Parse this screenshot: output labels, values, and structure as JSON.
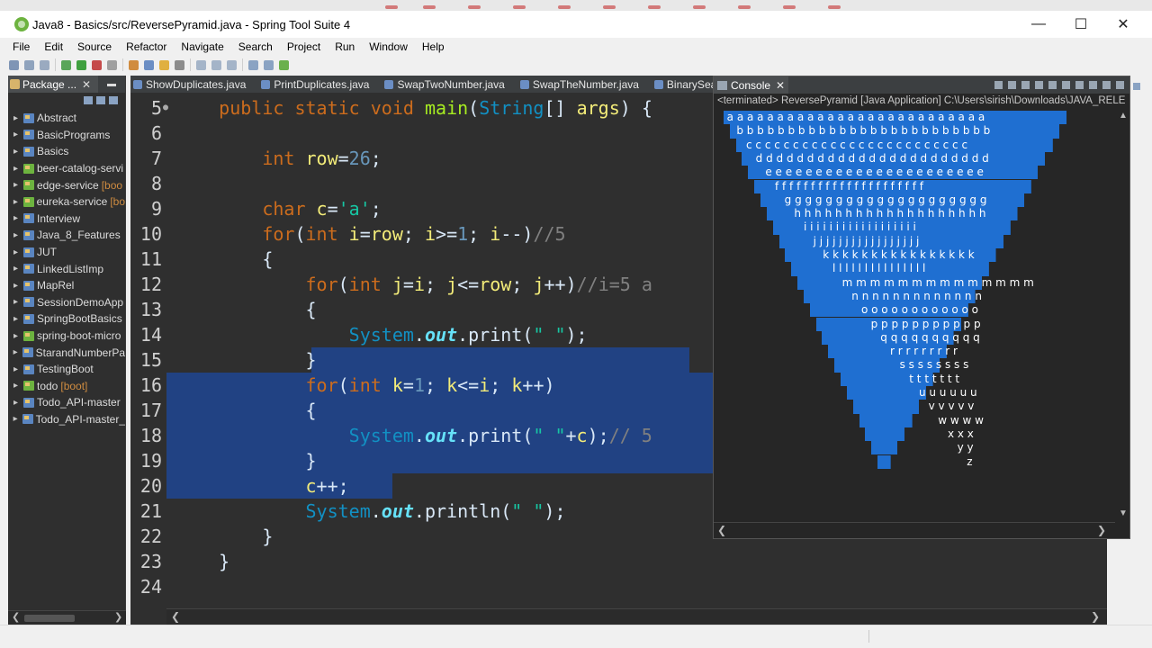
{
  "window": {
    "title": "Java8 - Basics/src/ReversePyramid.java - Spring Tool Suite 4",
    "minimize_icon": "minimize-icon",
    "maximize_icon": "maximize-icon",
    "close_icon": "close-icon",
    "minimize_glyph": "—",
    "maximize_glyph": "☐",
    "close_glyph": "✕"
  },
  "menu": [
    "File",
    "Edit",
    "Source",
    "Refactor",
    "Navigate",
    "Search",
    "Project",
    "Run",
    "Window",
    "Help"
  ],
  "package_explorer": {
    "tab_label": "Package ...",
    "projects": [
      {
        "name": "Abstract",
        "tag": "",
        "icon": "java-project-icon"
      },
      {
        "name": "BasicPrograms",
        "tag": "",
        "icon": "java-project-icon"
      },
      {
        "name": "Basics",
        "tag": "",
        "icon": "java-project-icon"
      },
      {
        "name": "beer-catalog-servi",
        "tag": "",
        "icon": "spring-project-icon"
      },
      {
        "name": "edge-service",
        "tag": "[boo",
        "icon": "spring-project-icon"
      },
      {
        "name": "eureka-service",
        "tag": "[bo",
        "icon": "spring-project-icon"
      },
      {
        "name": "Interview",
        "tag": "",
        "icon": "java-project-icon"
      },
      {
        "name": "Java_8_Features",
        "tag": "",
        "icon": "java-project-icon"
      },
      {
        "name": "JUT",
        "tag": "",
        "icon": "java-project-icon"
      },
      {
        "name": "LinkedListImp",
        "tag": "",
        "icon": "java-project-icon"
      },
      {
        "name": "MapRel",
        "tag": "",
        "icon": "java-project-icon"
      },
      {
        "name": "SessionDemoApp",
        "tag": "",
        "icon": "java-project-icon"
      },
      {
        "name": "SpringBootBasics",
        "tag": "",
        "icon": "java-project-icon"
      },
      {
        "name": "spring-boot-micro",
        "tag": "",
        "icon": "spring-project-icon"
      },
      {
        "name": "StarandNumberPa",
        "tag": "",
        "icon": "java-project-icon"
      },
      {
        "name": "TestingBoot",
        "tag": "",
        "icon": "java-project-icon"
      },
      {
        "name": "todo",
        "tag": "[boot]",
        "icon": "spring-project-icon"
      },
      {
        "name": "Todo_API-master",
        "tag": "",
        "icon": "java-project-icon"
      },
      {
        "name": "Todo_API-master_",
        "tag": "",
        "icon": "java-project-icon"
      }
    ]
  },
  "editor": {
    "tabs": [
      "ShowDuplicates.java",
      "PrintDuplicates.java",
      "SwapTwoNumber.java",
      "SwapTheNumber.java",
      "BinarySearc"
    ],
    "line_numbers": [
      "5",
      "6",
      "7",
      "8",
      "9",
      "10",
      "11",
      "12",
      "13",
      "14",
      "15",
      "16",
      "17",
      "18",
      "19",
      "20",
      "21",
      "22",
      "23",
      "24"
    ],
    "lines": [
      "    public static void main(String[] args) {",
      "",
      "        int row=26;",
      "",
      "        char c='a';",
      "        for(int i=row; i>=1; i--)//5",
      "        {",
      "            for(int j=i; j<=row; j++)//i=5 a",
      "            {",
      "                System.out.print(\" \");",
      "            }",
      "            for(int k=1; k<=i; k++)",
      "            {",
      "                System.out.print(\" \"+c);// 5",
      "            }",
      "            c++;",
      "            System.out.println(\" \");",
      "        }",
      "    }",
      ""
    ]
  },
  "console": {
    "tab_label": "Console",
    "status": "<terminated> ReversePyramid [Java Application] C:\\Users\\sirish\\Downloads\\JAVA_RELE",
    "rows": [
      " a a a a a a a a a a a a a a a a a a a a a a a a a a",
      "  b b b b b b b b b b b b b b b b b b b b b b b b b",
      "   c c c c c c c c c c c c c c c c c c c c c c c c",
      "    d d d d d d d d d d d d d d d d d d d d d d d",
      "     e e e e e e e e e e e e e e e e e e e e e e",
      "      f f f f f f f f f f f f f f f f f f f f f",
      "       g g g g g g g g g g g g g g g g g g g g",
      "        h h h h h h h h h h h h h h h h h h h",
      "         i i i i i i i i i i i i i i i i i i",
      "          j j j j j j j j j j j j j j j j j",
      "           k k k k k k k k k k k k k k k k",
      "            l l l l l l l l l l l l l l l",
      "             m m m m m m m m m m m m m m",
      "              n n n n n n n n n n n n n",
      "               o o o o o o o o o o o o",
      "                p p p p p p p p p p p",
      "                 q q q q q q q q q q",
      "                  r r r r r r r r r",
      "                   s s s s s s s s",
      "                    t t t t t t t",
      "                     u u u u u u",
      "                      v v v v v",
      "                       w w w w",
      "                        x x x",
      "                         y y",
      "                          z"
    ]
  }
}
